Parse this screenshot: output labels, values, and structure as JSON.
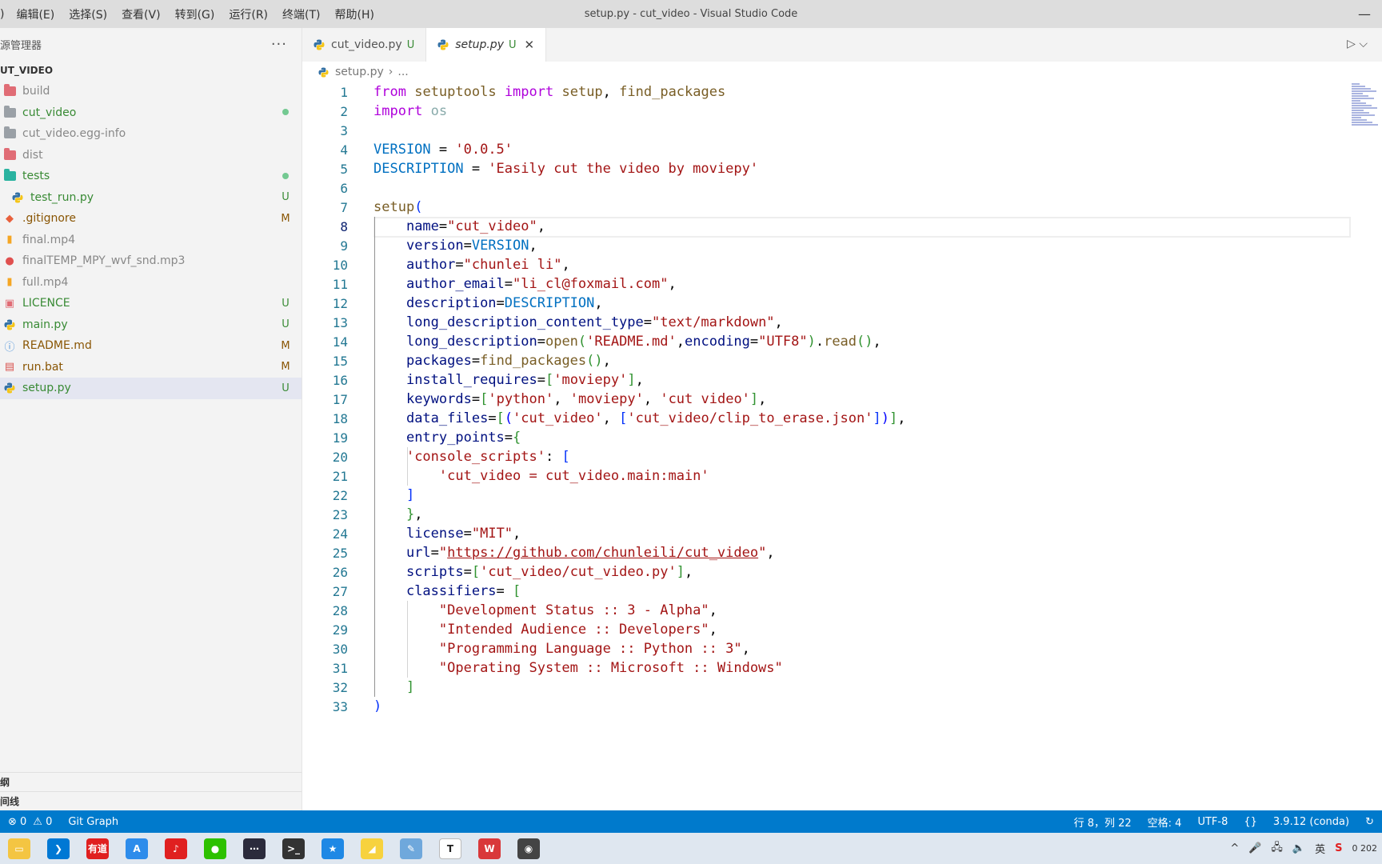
{
  "menubar": {
    "items": [
      ")",
      "编辑(E)",
      "选择(S)",
      "查看(V)",
      "转到(G)",
      "运行(R)",
      "终端(T)",
      "帮助(H)"
    ],
    "window_title": "setup.py - cut_video - Visual Studio Code",
    "minimize": "—"
  },
  "sidebar": {
    "title": "源管理器",
    "more": "···",
    "root": "UT_VIDEO",
    "items": [
      {
        "name": "build",
        "status": "",
        "kind": "folder",
        "color": "#e06c75",
        "name_color": "#888888"
      },
      {
        "name": "cut_video",
        "status": "dot",
        "kind": "folder",
        "color": "#9aa0a6",
        "name_color": "#388a34"
      },
      {
        "name": "cut_video.egg-info",
        "status": "",
        "kind": "folder",
        "color": "#9aa0a6",
        "name_color": "#888888"
      },
      {
        "name": "dist",
        "status": "",
        "kind": "folder",
        "color": "#e06c75",
        "name_color": "#888888"
      },
      {
        "name": "tests",
        "status": "dot",
        "kind": "folder",
        "color": "#2ab3a0",
        "name_color": "#388a34"
      },
      {
        "name": "test_run.py",
        "status": "U",
        "kind": "python",
        "color": "#3572a5",
        "name_color": "#388a34",
        "indent": true
      },
      {
        "name": ".gitignore",
        "status": "M",
        "kind": "git",
        "color": "#e8603c",
        "name_color": "#895503"
      },
      {
        "name": "final.mp4",
        "status": "",
        "kind": "video",
        "color": "#f5a623",
        "name_color": "#888888"
      },
      {
        "name": "finalTEMP_MPY_wvf_snd.mp3",
        "status": "",
        "kind": "audio",
        "color": "#e0504f",
        "name_color": "#888888"
      },
      {
        "name": "full.mp4",
        "status": "",
        "kind": "video",
        "color": "#f5a623",
        "name_color": "#888888"
      },
      {
        "name": "LICENCE",
        "status": "U",
        "kind": "licence",
        "color": "#e06c75",
        "name_color": "#388a34"
      },
      {
        "name": "main.py",
        "status": "U",
        "kind": "python",
        "color": "#3572a5",
        "name_color": "#388a34"
      },
      {
        "name": "README.md",
        "status": "M",
        "kind": "info",
        "color": "#4a90d9",
        "name_color": "#895503"
      },
      {
        "name": "run.bat",
        "status": "M",
        "kind": "bat",
        "color": "#d9534f",
        "name_color": "#895503"
      },
      {
        "name": "setup.py",
        "status": "U",
        "kind": "python",
        "color": "#3572a5",
        "name_color": "#388a34",
        "selected": true
      }
    ],
    "bottom": [
      "纲",
      "间线"
    ]
  },
  "tabs": [
    {
      "label": "cut_video.py",
      "status": "U",
      "active": false
    },
    {
      "label": "setup.py",
      "status": "U",
      "active": true,
      "close": "✕"
    }
  ],
  "tab_actions": "▷ ⌵",
  "breadcrumb": {
    "file": "setup.py",
    "sep": "›",
    "rest": "..."
  },
  "editor": {
    "current_line": 8,
    "lines": [
      [
        [
          "k",
          "from"
        ],
        [
          "t",
          " "
        ],
        [
          "f",
          "setuptools"
        ],
        [
          "t",
          " "
        ],
        [
          "k",
          "import"
        ],
        [
          "t",
          " "
        ],
        [
          "f",
          "setup"
        ],
        [
          "t",
          ", "
        ],
        [
          "f",
          "find_packages"
        ]
      ],
      [
        [
          "k",
          "import"
        ],
        [
          "t",
          " "
        ],
        [
          "dim",
          "os"
        ]
      ],
      [],
      [
        [
          "v",
          "VERSION"
        ],
        [
          "t",
          " = "
        ],
        [
          "s",
          "'0.0.5'"
        ]
      ],
      [
        [
          "v",
          "DESCRIPTION"
        ],
        [
          "t",
          " = "
        ],
        [
          "s",
          "'Easily cut the video by moviepy'"
        ]
      ],
      [],
      [
        [
          "f",
          "setup"
        ],
        [
          "p2",
          "("
        ]
      ],
      [
        [
          "t",
          "    "
        ],
        [
          "pv",
          "name"
        ],
        [
          "t",
          "="
        ],
        [
          "s",
          "\"cut_video\""
        ],
        [
          "t",
          ","
        ]
      ],
      [
        [
          "t",
          "    "
        ],
        [
          "pv",
          "version"
        ],
        [
          "t",
          "="
        ],
        [
          "v",
          "VERSION"
        ],
        [
          "t",
          ","
        ]
      ],
      [
        [
          "t",
          "    "
        ],
        [
          "pv",
          "author"
        ],
        [
          "t",
          "="
        ],
        [
          "s",
          "\"chunlei li\""
        ],
        [
          "t",
          ","
        ]
      ],
      [
        [
          "t",
          "    "
        ],
        [
          "pv",
          "author_email"
        ],
        [
          "t",
          "="
        ],
        [
          "s",
          "\"li_cl@foxmail.com\""
        ],
        [
          "t",
          ","
        ]
      ],
      [
        [
          "t",
          "    "
        ],
        [
          "pv",
          "description"
        ],
        [
          "t",
          "="
        ],
        [
          "v",
          "DESCRIPTION"
        ],
        [
          "t",
          ","
        ]
      ],
      [
        [
          "t",
          "    "
        ],
        [
          "pv",
          "long_description_content_type"
        ],
        [
          "t",
          "="
        ],
        [
          "s",
          "\"text/markdown\""
        ],
        [
          "t",
          ","
        ]
      ],
      [
        [
          "t",
          "    "
        ],
        [
          "pv",
          "long_description"
        ],
        [
          "t",
          "="
        ],
        [
          "f",
          "open"
        ],
        [
          "p",
          "("
        ],
        [
          "s",
          "'README.md'"
        ],
        [
          "t",
          ","
        ],
        [
          "pv",
          "encoding"
        ],
        [
          "t",
          "="
        ],
        [
          "s",
          "\"UTF8\""
        ],
        [
          "p",
          ")"
        ],
        [
          "t",
          "."
        ],
        [
          "f",
          "read"
        ],
        [
          "p",
          "()"
        ],
        [
          "t",
          ","
        ]
      ],
      [
        [
          "t",
          "    "
        ],
        [
          "pv",
          "packages"
        ],
        [
          "t",
          "="
        ],
        [
          "f",
          "find_packages"
        ],
        [
          "p",
          "()"
        ],
        [
          "t",
          ","
        ]
      ],
      [
        [
          "t",
          "    "
        ],
        [
          "pv",
          "install_requires"
        ],
        [
          "t",
          "="
        ],
        [
          "p",
          "["
        ],
        [
          "s",
          "'moviepy'"
        ],
        [
          "p",
          "]"
        ],
        [
          "t",
          ","
        ]
      ],
      [
        [
          "t",
          "    "
        ],
        [
          "pv",
          "keywords"
        ],
        [
          "t",
          "="
        ],
        [
          "p",
          "["
        ],
        [
          "s",
          "'python'"
        ],
        [
          "t",
          ", "
        ],
        [
          "s",
          "'moviepy'"
        ],
        [
          "t",
          ", "
        ],
        [
          "s",
          "'cut video'"
        ],
        [
          "p",
          "]"
        ],
        [
          "t",
          ","
        ]
      ],
      [
        [
          "t",
          "    "
        ],
        [
          "pv",
          "data_files"
        ],
        [
          "t",
          "="
        ],
        [
          "p",
          "["
        ],
        [
          "kb",
          "("
        ],
        [
          "s",
          "'cut_video'"
        ],
        [
          "t",
          ", "
        ],
        [
          "p2",
          "["
        ],
        [
          "s",
          "'cut_video/clip_to_erase.json'"
        ],
        [
          "p2",
          "]"
        ],
        [
          "kb",
          ")"
        ],
        [
          "p",
          "]"
        ],
        [
          "t",
          ","
        ]
      ],
      [
        [
          "t",
          "    "
        ],
        [
          "pv",
          "entry_points"
        ],
        [
          "t",
          "="
        ],
        [
          "p",
          "{"
        ]
      ],
      [
        [
          "t",
          "    "
        ],
        [
          "s",
          "'console_scripts'"
        ],
        [
          "t",
          ": "
        ],
        [
          "p2",
          "["
        ]
      ],
      [
        [
          "t",
          "        "
        ],
        [
          "s",
          "'cut_video = cut_video.main:main'"
        ]
      ],
      [
        [
          "t",
          "    "
        ],
        [
          "p2",
          "]"
        ]
      ],
      [
        [
          "t",
          "    "
        ],
        [
          "p",
          "}"
        ],
        [
          "t",
          ","
        ]
      ],
      [
        [
          "t",
          "    "
        ],
        [
          "pv",
          "license"
        ],
        [
          "t",
          "="
        ],
        [
          "s",
          "\"MIT\""
        ],
        [
          "t",
          ","
        ]
      ],
      [
        [
          "t",
          "    "
        ],
        [
          "pv",
          "url"
        ],
        [
          "t",
          "="
        ],
        [
          "s",
          "\""
        ],
        [
          "url",
          "https://github.com/chunleili/cut_video"
        ],
        [
          "s",
          "\""
        ],
        [
          "t",
          ","
        ]
      ],
      [
        [
          "t",
          "    "
        ],
        [
          "pv",
          "scripts"
        ],
        [
          "t",
          "="
        ],
        [
          "p",
          "["
        ],
        [
          "s",
          "'cut_video/cut_video.py'"
        ],
        [
          "p",
          "]"
        ],
        [
          "t",
          ","
        ]
      ],
      [
        [
          "t",
          "    "
        ],
        [
          "pv",
          "classifiers"
        ],
        [
          "t",
          "= "
        ],
        [
          "p",
          "["
        ]
      ],
      [
        [
          "t",
          "        "
        ],
        [
          "s",
          "\"Development Status :: 3 - Alpha\""
        ],
        [
          "t",
          ","
        ]
      ],
      [
        [
          "t",
          "        "
        ],
        [
          "s",
          "\"Intended Audience :: Developers\""
        ],
        [
          "t",
          ","
        ]
      ],
      [
        [
          "t",
          "        "
        ],
        [
          "s",
          "\"Programming Language :: Python :: 3\""
        ],
        [
          "t",
          ","
        ]
      ],
      [
        [
          "t",
          "        "
        ],
        [
          "s",
          "\"Operating System :: Microsoft :: Windows\""
        ]
      ],
      [
        [
          "t",
          "    "
        ],
        [
          "p",
          "]"
        ]
      ],
      [
        [
          "p2",
          ")"
        ]
      ]
    ]
  },
  "statusbar": {
    "errors": "⊗ 0",
    "warnings": "⚠ 0",
    "git_graph": "Git Graph",
    "position": "行 8，列 22",
    "spaces": "空格: 4",
    "encoding": "UTF-8",
    "braces": "{}",
    "interpreter": "3.9.12 (conda)",
    "sync": "↻"
  },
  "taskbar": {
    "apps": [
      {
        "name": "file-explorer-icon",
        "color": "#f4c542",
        "glyph": "▭"
      },
      {
        "name": "vscode-icon",
        "color": "#0078d4",
        "glyph": "❯",
        "active": true
      },
      {
        "name": "youdao-icon",
        "color": "#e02020",
        "glyph": "有道"
      },
      {
        "name": "translate-icon",
        "color": "#2d8ceb",
        "glyph": "A"
      },
      {
        "name": "netease-music-icon",
        "color": "#e02020",
        "glyph": "♪"
      },
      {
        "name": "wechat-icon",
        "color": "#2dc100",
        "glyph": "●"
      },
      {
        "name": "terminal-dark-icon",
        "color": "#2b2b3c",
        "glyph": "⋯"
      },
      {
        "name": "cmd-icon",
        "color": "#333333",
        "glyph": ">_"
      },
      {
        "name": "star-app-icon",
        "color": "#1e88e5",
        "glyph": "★"
      },
      {
        "name": "sticky-notes-icon",
        "color": "#f7d23e",
        "glyph": "◢"
      },
      {
        "name": "pen-app-icon",
        "color": "#6fa8dc",
        "glyph": "✎"
      },
      {
        "name": "typora-icon",
        "color": "#ffffff",
        "glyph": "T"
      },
      {
        "name": "wps-icon",
        "color": "#d9383a",
        "glyph": "W"
      },
      {
        "name": "obs-icon",
        "color": "#444444",
        "glyph": "◉"
      }
    ],
    "tray": [
      "^",
      "🎤",
      "🖧",
      "🔈",
      "英",
      "S"
    ],
    "clock": "0 202"
  }
}
